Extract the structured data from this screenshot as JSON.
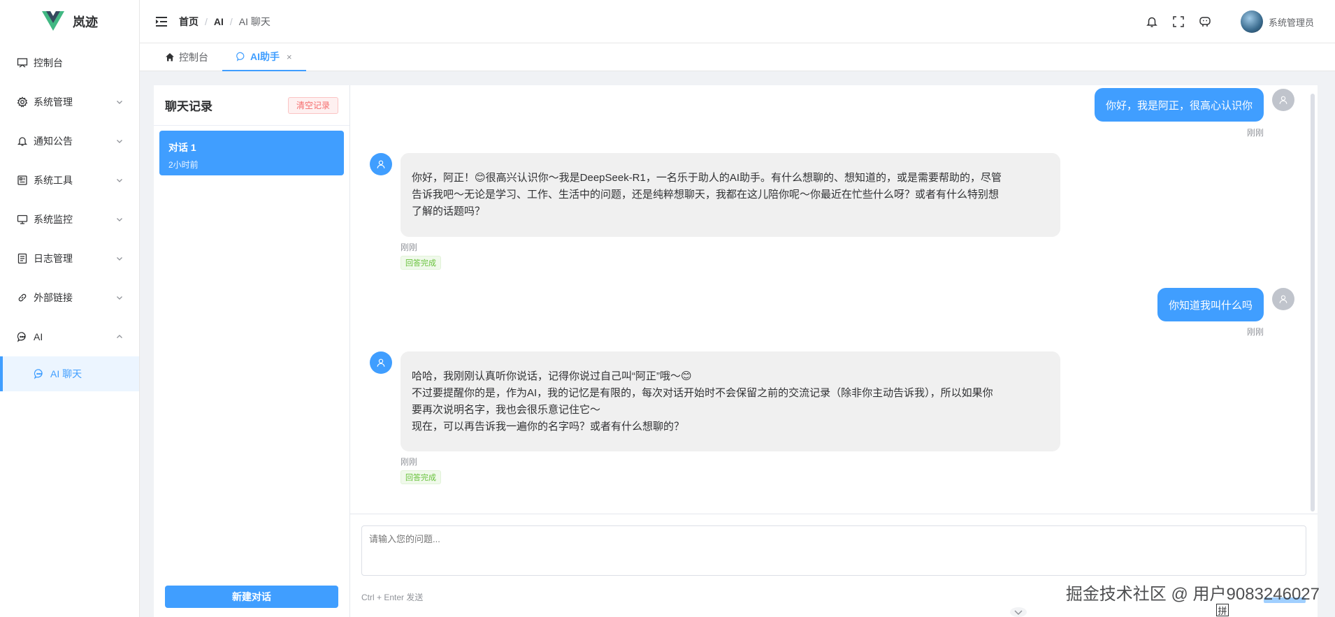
{
  "sidebar": {
    "logo_text": "岚迹",
    "items": [
      {
        "label": "控制台",
        "icon": "monitor-icon"
      },
      {
        "label": "系统管理",
        "icon": "gear-icon"
      },
      {
        "label": "通知公告",
        "icon": "bell-icon"
      },
      {
        "label": "系统工具",
        "icon": "toolbox-icon"
      },
      {
        "label": "系统监控",
        "icon": "screen-icon"
      },
      {
        "label": "日志管理",
        "icon": "document-icon"
      },
      {
        "label": "外部链接",
        "icon": "link-icon"
      },
      {
        "label": "AI",
        "icon": "chat-icon"
      }
    ],
    "sub_item": {
      "label": "AI 聊天",
      "icon": "chat-icon"
    }
  },
  "header": {
    "breadcrumb": [
      "首页",
      "AI",
      "AI 聊天"
    ],
    "username": "系统管理员"
  },
  "tabs": [
    {
      "label": "控制台",
      "icon": "home-icon"
    },
    {
      "label": "AI助手",
      "icon": "chat-icon",
      "close": "×"
    }
  ],
  "history": {
    "title": "聊天记录",
    "clear_label": "清空记录",
    "conversations": [
      {
        "title": "对话 1",
        "time": "2小时前"
      }
    ],
    "new_label": "新建对话"
  },
  "messages": [
    {
      "role": "user",
      "text": "你好，我是阿正，很高心认识你",
      "time": "刚刚"
    },
    {
      "role": "assistant",
      "lines": [
        "你好，阿正！😊很高兴认识你～我是DeepSeek-R1，一名乐于助人的AI助手。有什么想聊的、想知道的，或是需要帮助的，尽管",
        "告诉我吧～无论是学习、工作、生活中的问题，还是纯粹想聊天，我都在这儿陪你呢～你最近在忙些什么呀？或者有什么特别想",
        "了解的话题吗？"
      ],
      "time": "刚刚",
      "status": "回答完成"
    },
    {
      "role": "user",
      "text": "你知道我叫什么吗",
      "time": "刚刚"
    },
    {
      "role": "assistant",
      "lines": [
        "哈哈，我刚刚认真听你说话，记得你说过自己叫“阿正”哦～😊",
        "不过要提醒你的是，作为AI，我的记忆是有限的，每次对话开始时不会保留之前的交流记录（除非你主动告诉我），所以如果你",
        "要再次说明名字，我也会很乐意记住它～",
        "现在，可以再告诉我一遍你的名字吗？或者有什么想聊的？"
      ],
      "time": "刚刚",
      "status": "回答完成"
    }
  ],
  "input": {
    "placeholder": "请输入您的问题...",
    "hint": "Ctrl + Enter 发送"
  },
  "watermark": "掘金技术社区 @ 用户9083246027",
  "ime_label": "拼",
  "colors": {
    "accent": "#409eff",
    "success": "#67c23a",
    "danger": "#f56c6c"
  }
}
